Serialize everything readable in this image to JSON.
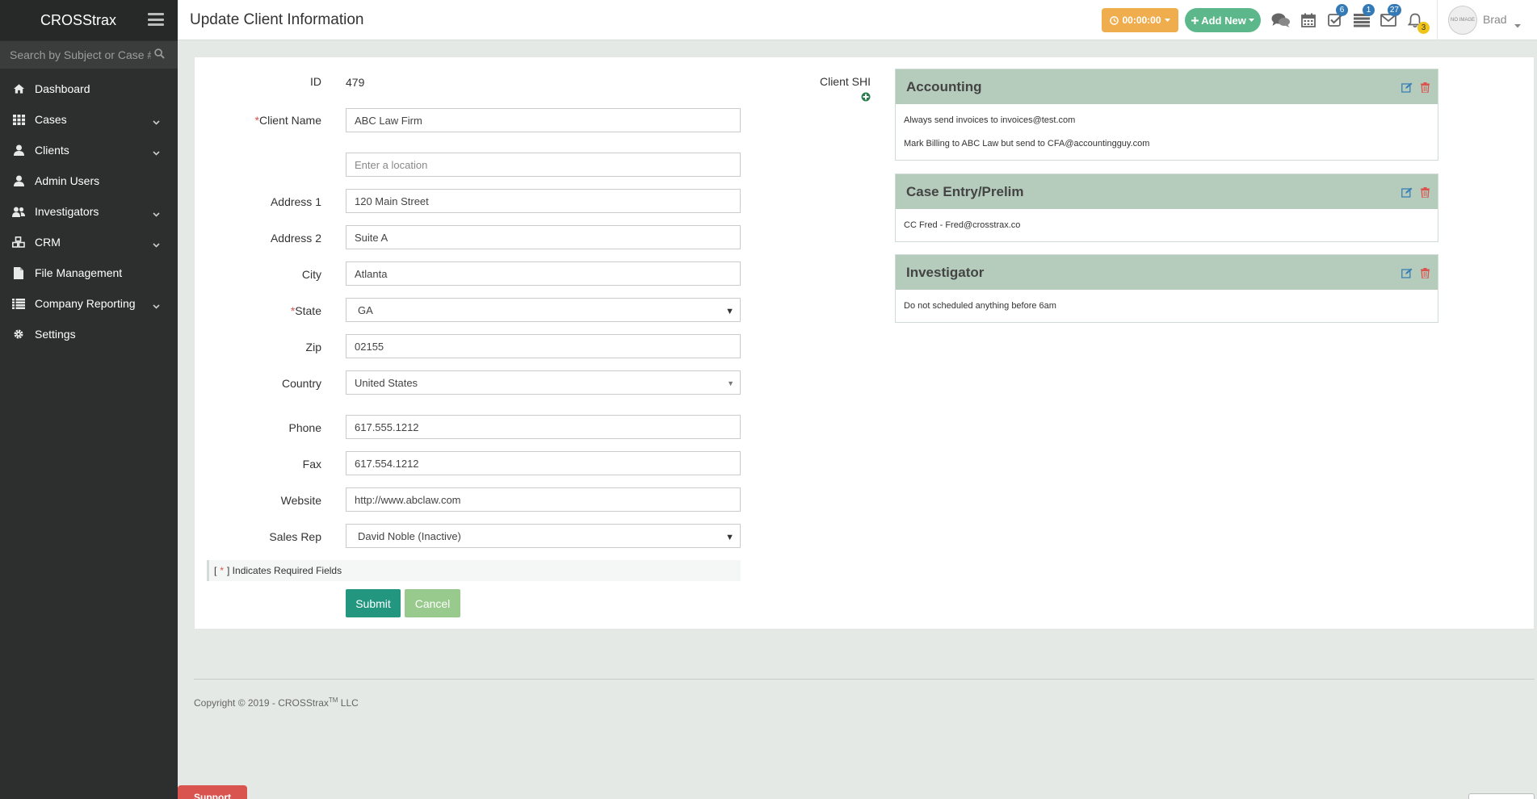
{
  "app": {
    "brand": "CROSStrax"
  },
  "sidebar": {
    "search_placeholder": "Search by Subject or Case #",
    "items": [
      {
        "label": "Dashboard",
        "icon": "home-icon",
        "has_submenu": false
      },
      {
        "label": "Cases",
        "icon": "grid-icon",
        "has_submenu": true
      },
      {
        "label": "Clients",
        "icon": "user-icon",
        "has_submenu": true
      },
      {
        "label": "Admin Users",
        "icon": "user-icon",
        "has_submenu": false
      },
      {
        "label": "Investigators",
        "icon": "users-icon",
        "has_submenu": true
      },
      {
        "label": "CRM",
        "icon": "cubes-icon",
        "has_submenu": true
      },
      {
        "label": "File Management",
        "icon": "file-icon",
        "has_submenu": false
      },
      {
        "label": "Company Reporting",
        "icon": "list-icon",
        "has_submenu": true
      },
      {
        "label": "Settings",
        "icon": "gear-icon",
        "has_submenu": false
      }
    ]
  },
  "header": {
    "title": "Update Client Information",
    "timer": "00:00:00",
    "add_new": "Add New",
    "badges": {
      "tasks": "6",
      "cases": "1",
      "mail": "27",
      "alerts": "3"
    },
    "user": {
      "name": "Brad",
      "avatar_text": "NO IMAGE"
    }
  },
  "form": {
    "id_label": "ID",
    "id_value": "479",
    "client_name_label": "Client Name",
    "client_name": "ABC Law Firm",
    "location_placeholder": "Enter a location",
    "address1_label": "Address 1",
    "address1": "120 Main Street",
    "address2_label": "Address 2",
    "address2": "Suite A",
    "city_label": "City",
    "city": "Atlanta",
    "state_label": "State",
    "state": "GA",
    "zip_label": "Zip",
    "zip": "02155",
    "country_label": "Country",
    "country": "United States",
    "phone_label": "Phone",
    "phone": "617.555.1212",
    "fax_label": "Fax",
    "fax": "617.554.1212",
    "website_label": "Website",
    "website": "http://www.abclaw.com",
    "sales_rep_label": "Sales Rep",
    "sales_rep": "David Noble (Inactive)",
    "required_note_open": "[",
    "required_star": "*",
    "required_note_text": "] Indicates Required Fields",
    "submit": "Submit",
    "cancel": "Cancel"
  },
  "client_shi": {
    "label": "Client SHI"
  },
  "notes": [
    {
      "title": "Accounting",
      "lines": [
        "Always send invoices to invoices@test.com",
        "Mark Billing to ABC Law but send to CFA@accountingguy.com"
      ]
    },
    {
      "title": "Case Entry/Prelim",
      "lines": [
        "CC Fred - Fred@crosstrax.co"
      ]
    },
    {
      "title": "Investigator",
      "lines": [
        "Do not scheduled anything before 6am"
      ]
    }
  ],
  "footer": {
    "copyright_prefix": "Copyright © 2019 - CROSStrax",
    "tm": "TM",
    "copyright_suffix": " LLC"
  },
  "support": {
    "label": "Support"
  },
  "colors": {
    "sidebar_bg": "#2c2f2e",
    "timer": "#f0ad4e",
    "add_new": "#5cb88a",
    "note_header": "#b5ccbd",
    "submit": "#23967f",
    "cancel": "#98c98d",
    "required": "#d9534f"
  }
}
